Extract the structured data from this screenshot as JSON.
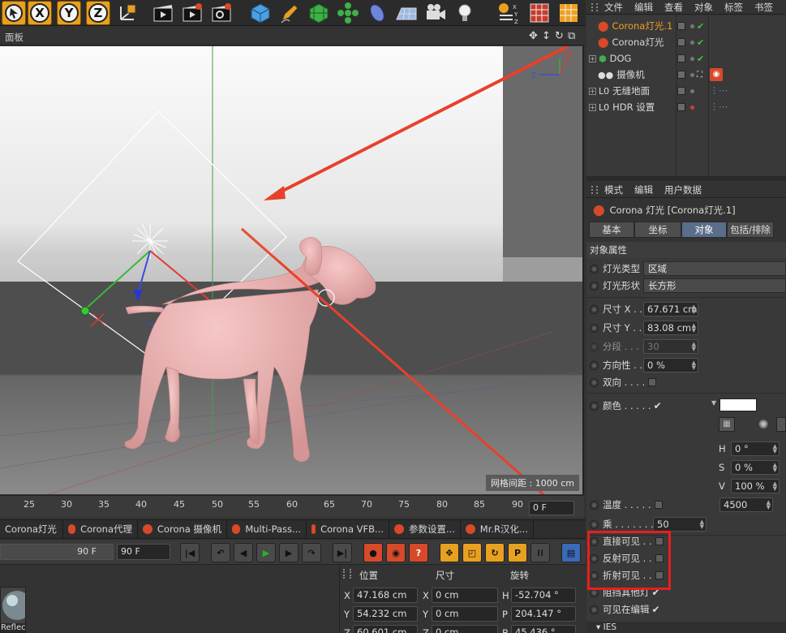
{
  "toolbar": {
    "axis_x": "X",
    "axis_y": "Y",
    "axis_z": "Z",
    "icons": [
      "cursor-icon",
      "coordinate-system-icon",
      "render-view-icon",
      "render-picture-icon",
      "render-settings-icon",
      "cube-icon",
      "pen-icon",
      "subdivision-icon",
      "cloner-icon",
      "deformer-icon",
      "floor-icon",
      "camera-icon",
      "light-icon",
      "axis-tool-icon",
      "texture-icon",
      "corona-icon"
    ]
  },
  "viewport": {
    "panel_label": "面板",
    "grid_spacing": "网格间距 : 1000 cm"
  },
  "timeline": {
    "ticks": [
      "25",
      "30",
      "35",
      "40",
      "45",
      "50",
      "55",
      "60",
      "65",
      "70",
      "75",
      "80",
      "85",
      "90"
    ],
    "current_frame": "0 F"
  },
  "plugin_tabs": [
    "Corona灯光",
    "Corona代理",
    "Corona 摄像机",
    "Multi-Pass...",
    "Corona VFB...",
    "参数设置...",
    "Mr.R汉化..."
  ],
  "playback": {
    "end_frame_a": "90 F",
    "end_frame_b": "90 F"
  },
  "material": {
    "label": "Reflect"
  },
  "coords": {
    "headers": [
      "位置",
      "尺寸",
      "旋转"
    ],
    "rows": [
      {
        "axis": "X",
        "pos": "47.168 cm",
        "size_axis": "X",
        "size": "0 cm",
        "rot_axis": "H",
        "rot": "-52.704 °"
      },
      {
        "axis": "Y",
        "pos": "54.232 cm",
        "size_axis": "Y",
        "size": "0 cm",
        "rot_axis": "P",
        "rot": "204.147 °"
      },
      {
        "axis": "Z",
        "pos": "60.601 cm",
        "size_axis": "Z",
        "size": "0 cm",
        "rot_axis": "B",
        "rot": "45.436 °"
      }
    ]
  },
  "object_manager": {
    "menu": [
      "文件",
      "编辑",
      "查看",
      "对象",
      "标签",
      "书签"
    ],
    "objects": [
      {
        "name": "Corona灯光.1",
        "selected": true
      },
      {
        "name": "Corona灯光",
        "selected": false
      },
      {
        "name": "DOG",
        "selected": false
      },
      {
        "name": "摄像机",
        "selected": false
      },
      {
        "name": "无缝地面",
        "selected": false
      },
      {
        "name": "HDR 设置",
        "selected": false
      }
    ]
  },
  "attributes": {
    "menu": [
      "模式",
      "编辑",
      "用户数据"
    ],
    "title": "Corona 灯光 [Corona灯光.1]",
    "tabs": [
      "基本",
      "坐标",
      "对象",
      "包括/排除"
    ],
    "section": "对象属性",
    "light_type_label": "灯光类型",
    "light_type_value": "区域",
    "light_shape_label": "灯光形状",
    "light_shape_value": "长方形",
    "size_x_label": "尺寸 X . .",
    "size_x_value": "67.671 cm",
    "size_y_label": "尺寸 Y . .",
    "size_y_value": "83.08 cm",
    "segments_label": "分段 . . . .",
    "segments_value": "30",
    "directionality_label": "方向性 . .",
    "directionality_value": "0 %",
    "two_sided_label": "双向 . . . .",
    "color_label": "颜色 . . . . .",
    "h_label": "H",
    "h_value": "0 °",
    "s_label": "S",
    "s_value": "0 %",
    "v_label": "V",
    "v_value": "100 %",
    "temperature_label": "温度 . . . . .",
    "temperature_value": "4500",
    "multiplier_label": "乘 . . . . . . .",
    "multiplier_value": "50",
    "visible_direct_label": "直接可见 . .",
    "visible_reflect_label": "反射可见 . .",
    "visible_refract_label": "折射可见 . .",
    "block_other_label": "阻挡其他灯",
    "visible_editor_label": "可见在编辑",
    "ies_label": "IES"
  },
  "colors": {
    "highlight": "#e81e1e",
    "arrow": "#e8402a",
    "dog": "#e9a9a9",
    "selected_object": "#f0a020"
  }
}
